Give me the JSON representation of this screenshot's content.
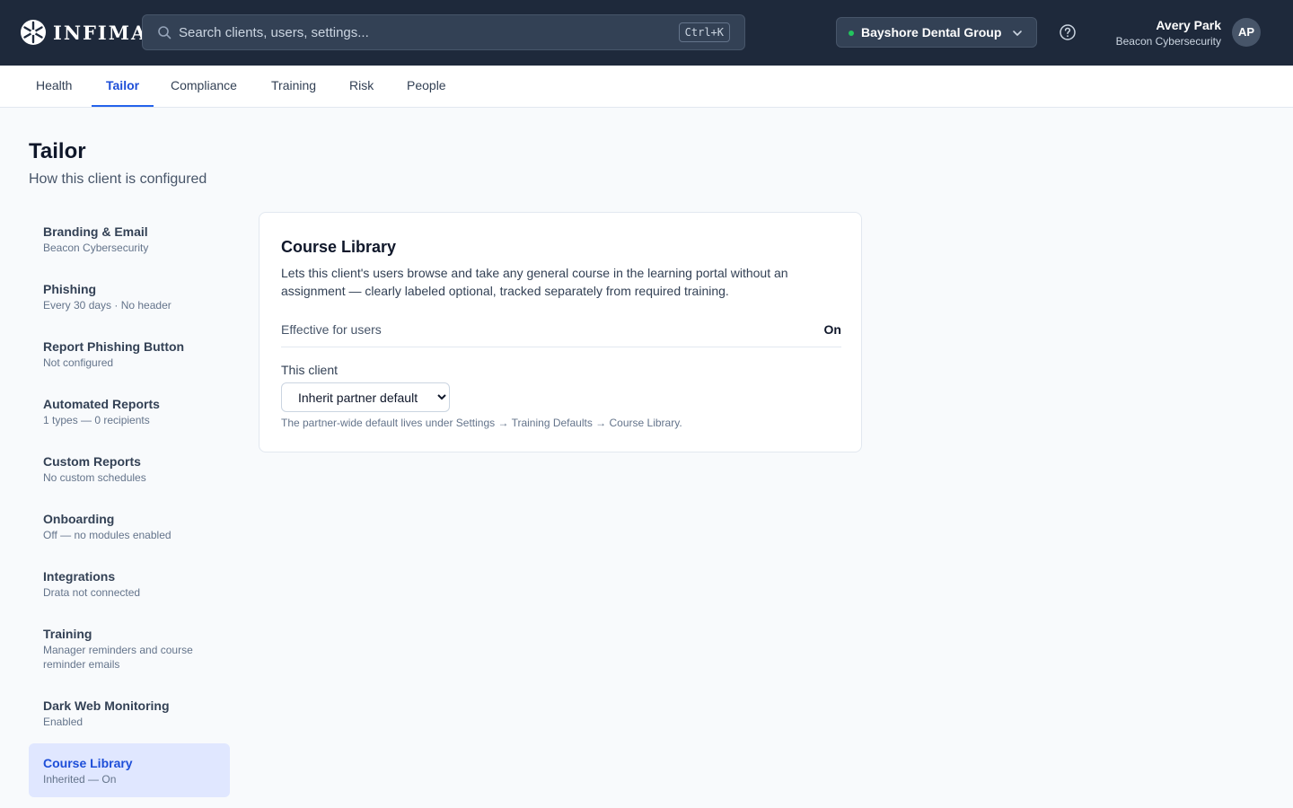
{
  "brand": {
    "name": "INFIMA",
    "icon": "snowflake-logo-icon"
  },
  "search": {
    "placeholder": "Search clients, users, settings...",
    "shortcut": "Ctrl+K",
    "icon": "search-icon"
  },
  "client_switcher": {
    "name": "Bayshore Dental Group",
    "status_color": "#22c55e",
    "icon": "chevron-down-icon"
  },
  "help": {
    "icon": "help-circle-icon"
  },
  "user": {
    "name": "Avery Park",
    "org": "Beacon Cybersecurity",
    "initials": "AP"
  },
  "tabs": [
    {
      "label": "Health",
      "active": false
    },
    {
      "label": "Tailor",
      "active": true
    },
    {
      "label": "Compliance",
      "active": false
    },
    {
      "label": "Training",
      "active": false
    },
    {
      "label": "Risk",
      "active": false
    },
    {
      "label": "People",
      "active": false
    }
  ],
  "page": {
    "title": "Tailor",
    "subtitle": "How this client is configured"
  },
  "sidebar": {
    "items": [
      {
        "label": "Branding & Email",
        "sub": "Beacon Cybersecurity"
      },
      {
        "label": "Phishing",
        "sub": "Every 30 days · No header"
      },
      {
        "label": "Report Phishing Button",
        "sub": "Not configured"
      },
      {
        "label": "Automated Reports",
        "sub": "1 types — 0 recipients"
      },
      {
        "label": "Custom Reports",
        "sub": "No custom schedules"
      },
      {
        "label": "Onboarding",
        "sub": "Off — no modules enabled"
      },
      {
        "label": "Integrations",
        "sub": "Drata not connected"
      },
      {
        "label": "Training",
        "sub": "Manager reminders and course reminder emails"
      },
      {
        "label": "Dark Web Monitoring",
        "sub": "Enabled"
      },
      {
        "label": "Course Library",
        "sub": "Inherited — On",
        "active": true
      }
    ]
  },
  "card": {
    "title": "Course Library",
    "description": "Lets this client's users browse and take any general course in the learning portal without an assignment — clearly labeled optional, tracked separately from required training.",
    "effective_label": "Effective for users",
    "effective_value": "On",
    "client_label": "This client",
    "select_value": "Inherit partner default",
    "hint": "The partner-wide default lives under Settings → Training Defaults → Course Library."
  },
  "colors": {
    "topbar": "#1e293b",
    "accent": "#2563eb",
    "active_bg": "#e0e7ff"
  }
}
